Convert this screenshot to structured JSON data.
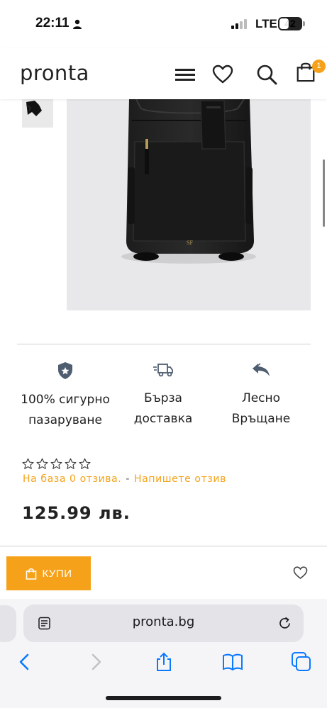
{
  "status_bar": {
    "time": "22:11",
    "network": "LTE",
    "battery": "42",
    "battery_level": 0.42
  },
  "header": {
    "logo": "pronta",
    "cart_count": "1"
  },
  "features": [
    {
      "label": "100% сигурно пазаруване",
      "icon": "shield-star-icon"
    },
    {
      "label": "Бърза доставка",
      "icon": "delivery-truck-icon"
    },
    {
      "label": "Лесно Връщане",
      "icon": "return-arrow-icon"
    }
  ],
  "rating": {
    "stars": 0,
    "max_stars": 5,
    "reviews_text": "На база 0 отзива.",
    "separator": "-",
    "write_review": "Напишете отзив"
  },
  "product": {
    "price": "125.99 лв."
  },
  "buy_bar": {
    "buy_label": "КУПИ"
  },
  "browser": {
    "url": "pronta.bg"
  },
  "colors": {
    "accent": "#f5a21a",
    "text": "#222222",
    "browser_bg": "#f5f5f7",
    "link": "#0a7aff"
  }
}
